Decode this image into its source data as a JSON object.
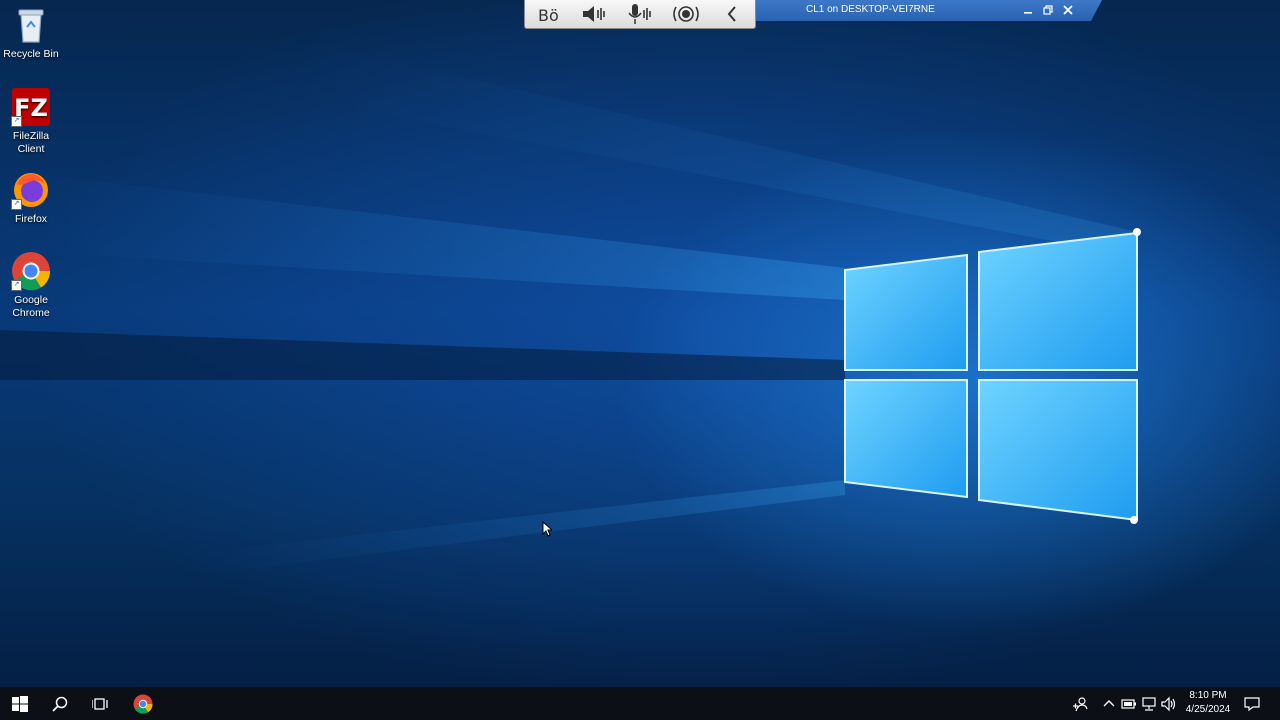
{
  "desktop": {
    "icons": [
      {
        "label_line1": "Recycle Bin",
        "label_line2": "",
        "icon": "recycle-bin-icon"
      },
      {
        "label_line1": "FileZilla",
        "label_line2": "Client",
        "icon": "filezilla-icon"
      },
      {
        "label_line1": "Firefox",
        "label_line2": "",
        "icon": "firefox-icon"
      },
      {
        "label_line1": "Google",
        "label_line2": "Chrome",
        "icon": "chrome-icon"
      }
    ]
  },
  "remote_toolbar": {
    "title": "CL1 on DESKTOP-VEI7RNE",
    "buttons": [
      "braille-icon",
      "speaker-icon",
      "microphone-icon",
      "broadcast-icon",
      "collapse-chevron-icon"
    ],
    "controls": [
      "minimize-icon",
      "restore-icon",
      "close-icon"
    ]
  },
  "taskbar": {
    "items": [
      "start-icon",
      "search-icon",
      "task-view-icon",
      "chrome-icon"
    ],
    "tray": [
      "people-icon",
      "chevron-up-icon",
      "battery-icon",
      "network-icon",
      "volume-icon"
    ],
    "time": "8:10 PM",
    "date": "4/25/2024",
    "notification_icon": "action-center-icon"
  },
  "colors": {
    "accent": "#2a62b0",
    "taskbar": "#0c0f16",
    "wallpaper_light": "#49c8ff"
  }
}
